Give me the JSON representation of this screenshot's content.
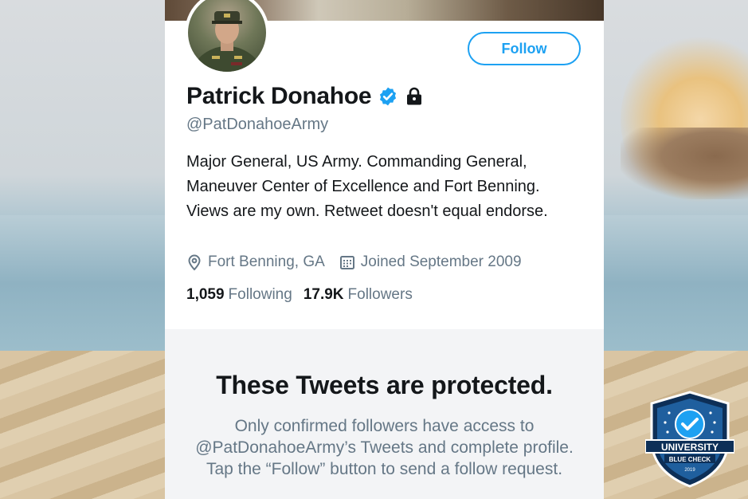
{
  "profile": {
    "name": "Patrick Donahoe",
    "handle": "@PatDonahoeArmy",
    "follow_label": "Follow",
    "bio": "Major General, US Army. Commanding General, Maneuver Center of Excellence and Fort Benning. Views are my own. Retweet doesn't equal endorse.",
    "location": "Fort Benning, GA",
    "joined": "Joined September 2009",
    "following_count": "1,059",
    "following_label": "Following",
    "followers_count": "17.9K",
    "followers_label": "Followers"
  },
  "protected": {
    "title": "These Tweets are protected.",
    "text": "Only confirmed followers have access to @PatDonahoeArmy’s Tweets and complete profile. Tap the “Follow” button to send a follow request."
  },
  "badge": {
    "line1": "UNIVERSITY",
    "line2": "BLUE CHECK",
    "line3": "2019"
  },
  "colors": {
    "accent": "#1da1f2",
    "text": "#14171a",
    "muted": "#657786",
    "protected_bg": "#f3f4f6"
  },
  "icons": [
    "verified-icon",
    "lock-icon",
    "location-icon",
    "calendar-icon",
    "checkmark-icon"
  ]
}
